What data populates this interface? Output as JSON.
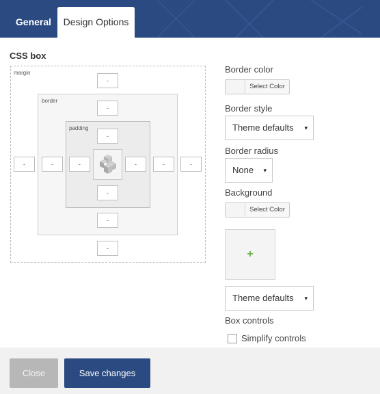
{
  "colors": {
    "header": "#2b4a82",
    "primary_button": "#2b4a82",
    "close_button": "#b7b7b7",
    "plus": "#6ab04c"
  },
  "tabs": {
    "general": "General",
    "design_options": "Design Options"
  },
  "css_box": {
    "title": "CSS box",
    "labels": {
      "margin": "margin",
      "border": "border",
      "padding": "padding"
    },
    "values": {
      "margin_top": "-",
      "margin_bottom": "-",
      "margin_left": "-",
      "margin_right": "-",
      "border_top": "-",
      "border_bottom": "-",
      "border_left": "-",
      "border_right": "-",
      "padding_top": "-",
      "padding_bottom": "-",
      "padding_left": "-",
      "padding_right": "-"
    }
  },
  "options": {
    "border_color": {
      "label": "Border color",
      "button": "Select Color"
    },
    "border_style": {
      "label": "Border style",
      "value": "Theme defaults"
    },
    "border_radius": {
      "label": "Border radius",
      "value": "None"
    },
    "background": {
      "label": "Background",
      "button": "Select Color",
      "add_image": "+",
      "select_value": "Theme defaults"
    },
    "box_controls": {
      "label": "Box controls",
      "simplify": "Simplify controls",
      "checked": false
    }
  },
  "footer": {
    "close": "Close",
    "save": "Save changes"
  },
  "icons": {
    "arrow": "▾",
    "logo": "vc-logo-icon"
  }
}
